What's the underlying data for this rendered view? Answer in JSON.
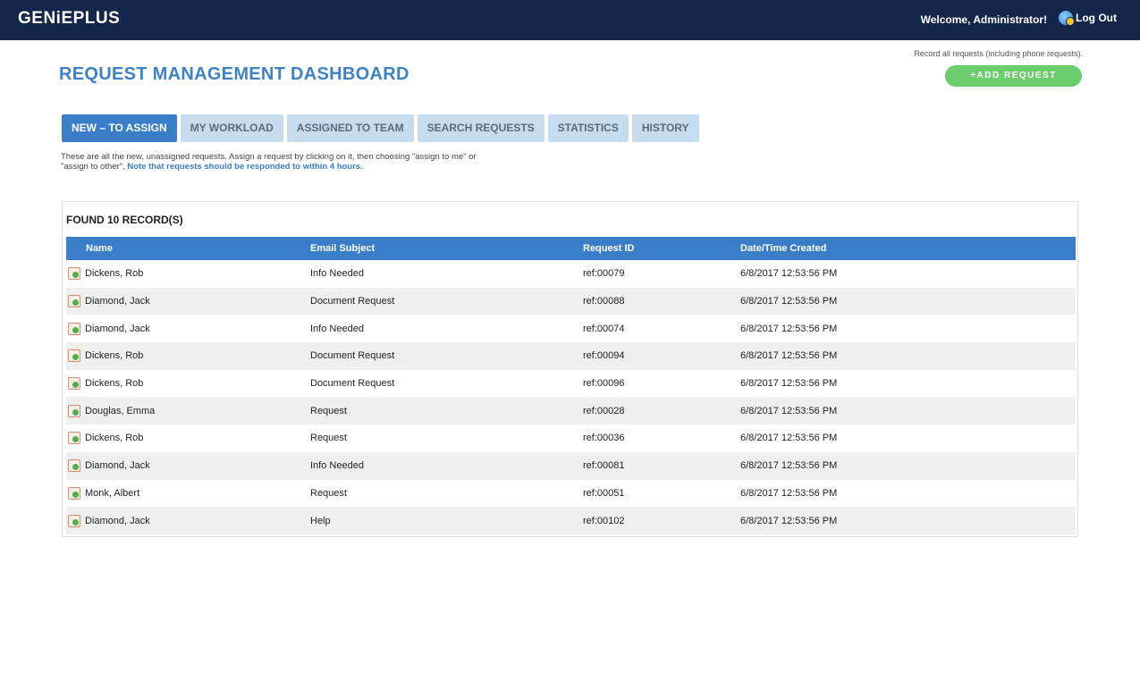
{
  "header": {
    "logo": "GENiEPLUS",
    "welcome": "Welcome, Administrator!",
    "logout_label": "Log Out"
  },
  "page": {
    "hint": "Record all requests (including phone requests).",
    "add_label": "+ADD REQUEST",
    "title": "REQUEST MANAGEMENT DASHBOARD"
  },
  "tabs": [
    {
      "label": "NEW – TO ASSIGN",
      "active": true
    },
    {
      "label": "MY WORKLOAD"
    },
    {
      "label": "ASSIGNED TO TEAM"
    },
    {
      "label": "SEARCH REQUESTS"
    },
    {
      "label": "STATISTICS"
    },
    {
      "label": "HISTORY"
    }
  ],
  "description": {
    "text": "These are all the new, unassigned requests. Assign a request by clicking on it, then choosing \"assign to me\" or \"assign to other\".",
    "note": "Note that requests should be responded to within 4 hours."
  },
  "records": {
    "found_label": "FOUND 10 RECORD(S)",
    "columns": [
      "Name",
      "Email Subject",
      "Request ID",
      "Date/Time Created"
    ],
    "rows": [
      {
        "name": "Dickens, Rob",
        "subject": "Info Needed",
        "id": "ref:00079",
        "created": "6/8/2017 12:53:56 PM"
      },
      {
        "name": "Diamond, Jack",
        "subject": "Document Request",
        "id": "ref:00088",
        "created": "6/8/2017 12:53:56 PM"
      },
      {
        "name": "Diamond, Jack",
        "subject": "Info Needed",
        "id": "ref:00074",
        "created": "6/8/2017 12:53:56 PM"
      },
      {
        "name": "Dickens, Rob",
        "subject": "Document Request",
        "id": "ref:00094",
        "created": "6/8/2017 12:53:56 PM"
      },
      {
        "name": "Dickens, Rob",
        "subject": "Document Request",
        "id": "ref:00096",
        "created": "6/8/2017 12:53:56 PM"
      },
      {
        "name": "Douglas, Emma",
        "subject": "Request",
        "id": "ref:00028",
        "created": "6/8/2017 12:53:56 PM"
      },
      {
        "name": "Dickens, Rob",
        "subject": "Request",
        "id": "ref:00036",
        "created": "6/8/2017 12:53:56 PM"
      },
      {
        "name": "Diamond, Jack",
        "subject": "Info Needed",
        "id": "ref:00081",
        "created": "6/8/2017 12:53:56 PM"
      },
      {
        "name": "Monk, Albert",
        "subject": "Request",
        "id": "ref:00051",
        "created": "6/8/2017 12:53:56 PM"
      },
      {
        "name": "Diamond, Jack",
        "subject": "Help",
        "id": "ref:00102",
        "created": "6/8/2017 12:53:56 PM"
      }
    ]
  },
  "colors": {
    "topbar": "#14264a",
    "accent": "#3a7dc9",
    "title": "#3f82c4",
    "add_button": "#6ccd6c",
    "tab_inactive": "#c7dcef"
  }
}
